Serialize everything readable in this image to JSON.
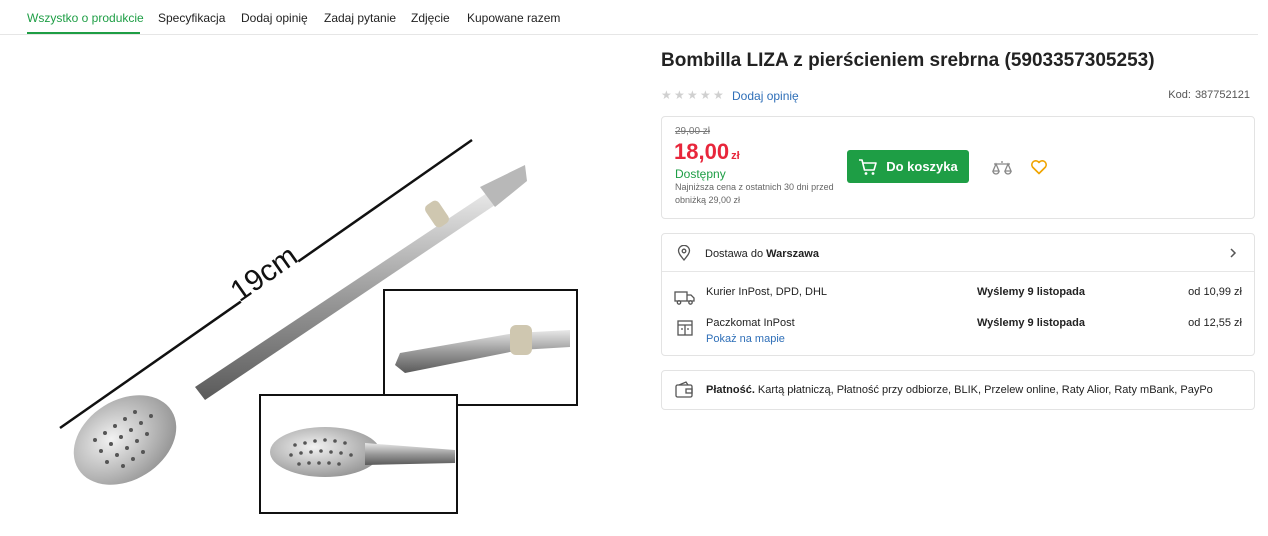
{
  "tabs": [
    {
      "label": "Wszystko o produkcie"
    },
    {
      "label": "Specyfikacja"
    },
    {
      "label": "Dodaj opinię"
    },
    {
      "label": "Zadaj pytanie"
    },
    {
      "label": "Zdjęcie"
    },
    {
      "label": "Kupowane razem"
    }
  ],
  "image": {
    "measure_label": "19cm"
  },
  "product": {
    "title": "Bombilla LIZA z pierścieniem srebrna (5903357305253)",
    "add_review": "Dodaj opinię",
    "rating_stars": 0,
    "kod_label": "Kod:",
    "kod_value": "387752121"
  },
  "price": {
    "old": "29,00 zł",
    "current": "18,00",
    "currency": "zł",
    "status": "Dostępny",
    "lowest_note": "Najniższa cena z ostatnich 30 dni przed obniżką 29,00 zł",
    "cart_label": "Do koszyka"
  },
  "delivery": {
    "prefix": "Dostawa do",
    "city": "Warszawa",
    "rows": [
      {
        "method": "Kurier InPost, DPD, DHL",
        "date": "Wyślemy 9 listopada",
        "cost": "od 10,99 zł",
        "icon": "truck-icon"
      },
      {
        "method": "Paczkomat InPost",
        "date": "Wyślemy 9 listopada",
        "cost": "od 12,55 zł",
        "icon": "parcel-locker-icon"
      }
    ],
    "map_link": "Pokaż na mapie"
  },
  "payment": {
    "label": "Płatność.",
    "methods": "Kartą płatniczą, Płatność przy odbiorze, BLIK, Przelew online, Raty Alior, Raty mBank, PayPo"
  },
  "colors": {
    "accent": "#1e9e45",
    "price": "#e8263b",
    "link": "#2f6fb8"
  }
}
